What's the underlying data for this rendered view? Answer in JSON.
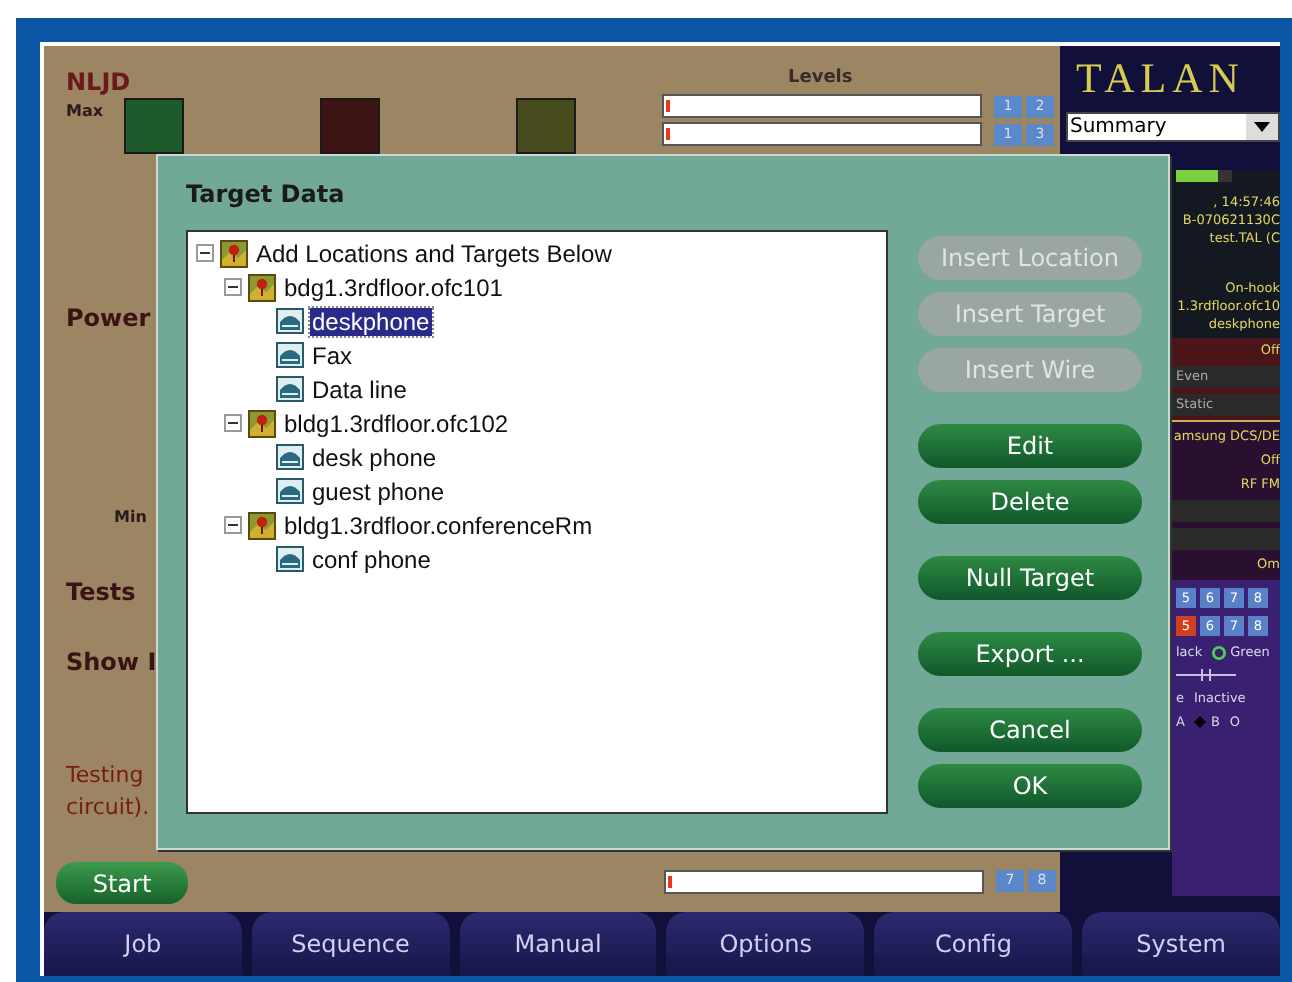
{
  "main_panel": {
    "heading": "NLJD",
    "max_label": "Max",
    "swatches": [
      {
        "color": "#1e5a2c"
      },
      {
        "color": "#3c1414"
      },
      {
        "color": "#474a1c"
      }
    ],
    "levels": {
      "heading": "Levels",
      "rows": [
        {
          "keys": [
            "1",
            "2"
          ]
        },
        {
          "keys": [
            "1",
            "3"
          ]
        }
      ],
      "bottom_row": {
        "keys": [
          "7",
          "8"
        ]
      }
    },
    "power_label": "Power",
    "min_label": "Min",
    "tests_label": "Tests",
    "show_label": "Show I",
    "note_lines": [
      "Testing",
      "circuit)."
    ],
    "start_button": "Start"
  },
  "side_panel": {
    "logo": "TALAN",
    "view_dropdown": "Summary",
    "signal_meter": {
      "level": 0.75
    },
    "lines_top": [
      ", 14:57:46",
      "B-070621130C",
      "test.TAL (C"
    ],
    "lines_mid": [
      "On-hook",
      "1.3rdfloor.ofc10",
      "deskphone"
    ],
    "red_band": {
      "status": "Off",
      "fields": [
        "Even",
        "Static"
      ]
    },
    "device_lines": [
      "amsung DCS/DE",
      "Off",
      "RF FM"
    ],
    "last_line": "Om",
    "key_rows": [
      [
        {
          "label": "5",
          "active": false
        },
        {
          "label": "6",
          "active": false
        },
        {
          "label": "7",
          "active": false
        },
        {
          "label": "8",
          "active": false
        }
      ],
      [
        {
          "label": "5",
          "active": true
        },
        {
          "label": "6",
          "active": false
        },
        {
          "label": "7",
          "active": false
        },
        {
          "label": "8",
          "active": false
        }
      ]
    ],
    "color_options": [
      {
        "label": "lack",
        "selected": false
      },
      {
        "label": "Green",
        "selected": true
      }
    ],
    "state_headers": [
      "e",
      "Inactive"
    ],
    "state_values": [
      {
        "label": "A",
        "selected": false
      },
      {
        "label": "B",
        "selected": true
      },
      {
        "label": "O",
        "selected": false
      }
    ]
  },
  "dialog": {
    "title": "Target Data",
    "tree": [
      {
        "label": "Add Locations and Targets Below",
        "kind": "location",
        "expanded": true,
        "selected": false,
        "children": [
          {
            "label": "bdg1.3rdfloor.ofc101",
            "kind": "location",
            "expanded": true,
            "selected": false,
            "children": [
              {
                "label": "deskphone",
                "kind": "target",
                "selected": true
              },
              {
                "label": "Fax",
                "kind": "target",
                "selected": false
              },
              {
                "label": "Data line",
                "kind": "target",
                "selected": false
              }
            ]
          },
          {
            "label": "bldg1.3rdfloor.ofc102",
            "kind": "location",
            "expanded": true,
            "selected": false,
            "children": [
              {
                "label": "desk phone",
                "kind": "target",
                "selected": false
              },
              {
                "label": "guest phone",
                "kind": "target",
                "selected": false
              }
            ]
          },
          {
            "label": "bldg1.3rdfloor.conferenceRm",
            "kind": "location",
            "expanded": true,
            "selected": false,
            "children": [
              {
                "label": "conf phone",
                "kind": "target",
                "selected": false
              }
            ]
          }
        ]
      }
    ],
    "button_groups": [
      [
        {
          "label": "Insert Location",
          "disabled": true
        },
        {
          "label": "Insert Target",
          "disabled": true
        },
        {
          "label": "Insert Wire",
          "disabled": true
        }
      ],
      [
        {
          "label": "Edit",
          "disabled": false
        },
        {
          "label": "Delete",
          "disabled": false
        }
      ],
      [
        {
          "label": "Null Target",
          "disabled": false
        }
      ],
      [
        {
          "label": "Export ...",
          "disabled": false
        }
      ],
      [
        {
          "label": "Cancel",
          "disabled": false
        },
        {
          "label": "OK",
          "disabled": false
        }
      ]
    ]
  },
  "nav_tabs": [
    "Job",
    "Sequence",
    "Manual",
    "Options",
    "Config",
    "System"
  ]
}
